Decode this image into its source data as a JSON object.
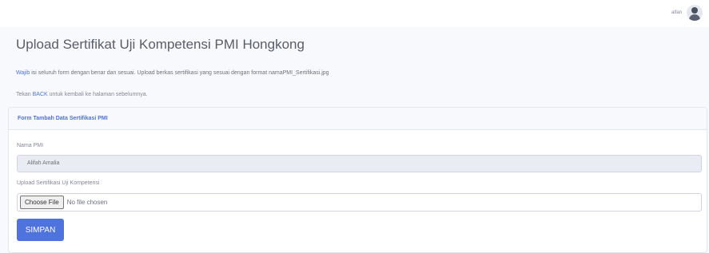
{
  "topbar": {
    "username": "aifan"
  },
  "page": {
    "title": "Upload Sertifikat Uji Kompetensi PMI Hongkong",
    "info_line1_link": "Wajib",
    "info_line1_text": " isi seluruh form dengan benar dan sesuai. Upload berkas sertifikasi yang sesuai dengan format namaPMI_Sertifikasi.jpg",
    "info_line2_prefix": "Tekan ",
    "info_line2_link": "BACK",
    "info_line2_suffix": " untuk kembali ke halaman sebelumnya."
  },
  "card": {
    "header": "Form Tambah Data Sertifikasi PMI",
    "nama_label": "Nama PMI",
    "nama_value": "Alifah Amalia",
    "upload_label": "Upload Sertifikasi Uji Kompetensi",
    "choose_file_label": "Choose File",
    "no_file_text": "No file chosen",
    "submit_label": "SIMPAN"
  },
  "colors": {
    "primary": "#4e73df",
    "background": "#f8f9fc",
    "readonly_input": "#eaecf4"
  }
}
